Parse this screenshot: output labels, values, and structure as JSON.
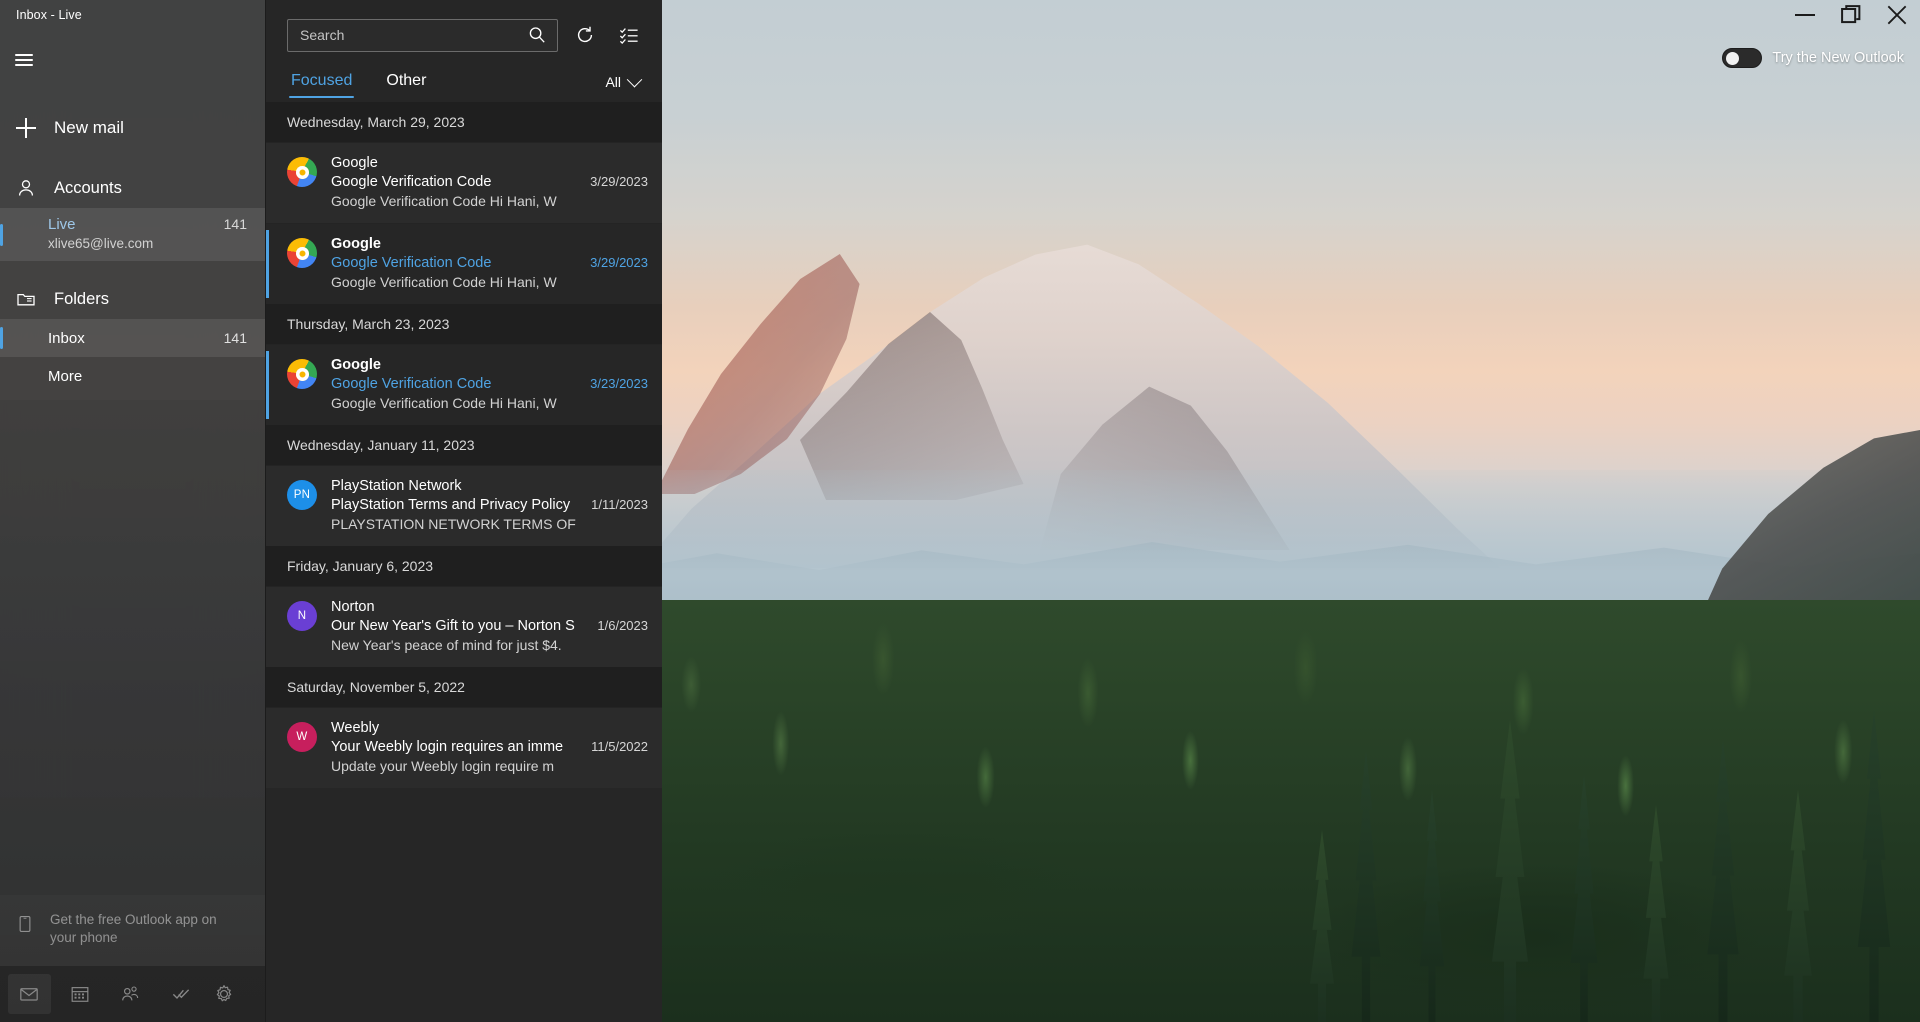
{
  "window": {
    "title": "Inbox - Live",
    "controls": [
      {
        "name": "minimize",
        "glyph": "minimize-icon"
      },
      {
        "name": "maximize",
        "glyph": "maximize-icon"
      },
      {
        "name": "close",
        "glyph": "close-icon"
      }
    ]
  },
  "try_new_outlook": {
    "label": "Try the New Outlook",
    "enabled": false
  },
  "sidebar": {
    "hamburger": "hamburger-icon",
    "new_mail": {
      "label": "New mail",
      "icon": "plus-icon"
    },
    "accounts": {
      "header": "Accounts",
      "icon": "person-icon",
      "items": [
        {
          "name": "Live",
          "email": "xlive65@live.com",
          "count": "141",
          "selected": true
        }
      ]
    },
    "folders": {
      "header": "Folders",
      "icon": "folder-icon",
      "items": [
        {
          "label": "Inbox",
          "count": "141",
          "selected": true
        },
        {
          "label": "More",
          "count": "",
          "selected": false
        }
      ]
    },
    "promo": {
      "icon": "phone-icon",
      "text": "Get the free Outlook app on your phone"
    },
    "bottom_nav": [
      {
        "name": "mail",
        "icon": "mail-icon",
        "active": true
      },
      {
        "name": "calendar",
        "icon": "calendar-icon",
        "active": false
      },
      {
        "name": "people",
        "icon": "people-icon",
        "active": false
      },
      {
        "name": "to-do",
        "icon": "todo-check-icon",
        "active": false
      },
      {
        "name": "settings",
        "icon": "gear-icon",
        "active": false
      }
    ]
  },
  "list": {
    "search": {
      "placeholder": "Search",
      "value": "",
      "icon": "search-icon"
    },
    "sync_icon": "sync-refresh-icon",
    "select_mode_icon": "select-list-icon",
    "tabs": [
      {
        "label": "Focused",
        "active": true
      },
      {
        "label": "Other",
        "active": false
      }
    ],
    "filter": {
      "label": "All",
      "icon": "chevron-down-icon"
    },
    "groups": [
      {
        "date": "Wednesday, March 29, 2023",
        "messages": [
          {
            "sender": "Google",
            "subject": "Google Verification Code",
            "preview": "Google Verification Code Hi Hani, W",
            "date": "3/29/2023",
            "unread": false,
            "avatar": {
              "type": "google",
              "initials": ""
            }
          },
          {
            "sender": "Google",
            "subject": "Google Verification Code",
            "preview": "Google Verification Code Hi Hani, W",
            "date": "3/29/2023",
            "unread": true,
            "avatar": {
              "type": "google",
              "initials": ""
            }
          }
        ]
      },
      {
        "date": "Thursday, March 23, 2023",
        "messages": [
          {
            "sender": "Google",
            "subject": "Google Verification Code",
            "preview": "Google Verification Code Hi Hani, W",
            "date": "3/23/2023",
            "unread": true,
            "avatar": {
              "type": "google",
              "initials": ""
            }
          }
        ]
      },
      {
        "date": "Wednesday, January 11, 2023",
        "messages": [
          {
            "sender": "PlayStation Network",
            "subject": "PlayStation Terms and Privacy Policy",
            "preview": "PLAYSTATION NETWORK TERMS OF",
            "date": "1/11/2023",
            "unread": false,
            "avatar": {
              "type": "initials",
              "initials": "PN",
              "color": "#1d8fe8"
            }
          }
        ]
      },
      {
        "date": "Friday, January 6, 2023",
        "messages": [
          {
            "sender": "Norton",
            "subject": "Our New Year's Gift to you – Norton S",
            "preview": "New Year's peace of mind for just $4.",
            "date": "1/6/2023",
            "unread": false,
            "avatar": {
              "type": "initials",
              "initials": "N",
              "color": "#6a3fd4"
            }
          }
        ]
      },
      {
        "date": "Saturday, November 5, 2022",
        "messages": [
          {
            "sender": "Weebly",
            "subject": "Your Weebly login requires an imme",
            "preview": "Update your Weebly login require m",
            "date": "11/5/2022",
            "unread": false,
            "avatar": {
              "type": "initials",
              "initials": "W",
              "color": "#c71f5d"
            }
          }
        ]
      }
    ]
  },
  "colors": {
    "accent": "#4fa3e3",
    "nav_bg": "#3a3a3a",
    "list_bg": "#262626",
    "msg_read_bg": "#2b2b2b"
  }
}
